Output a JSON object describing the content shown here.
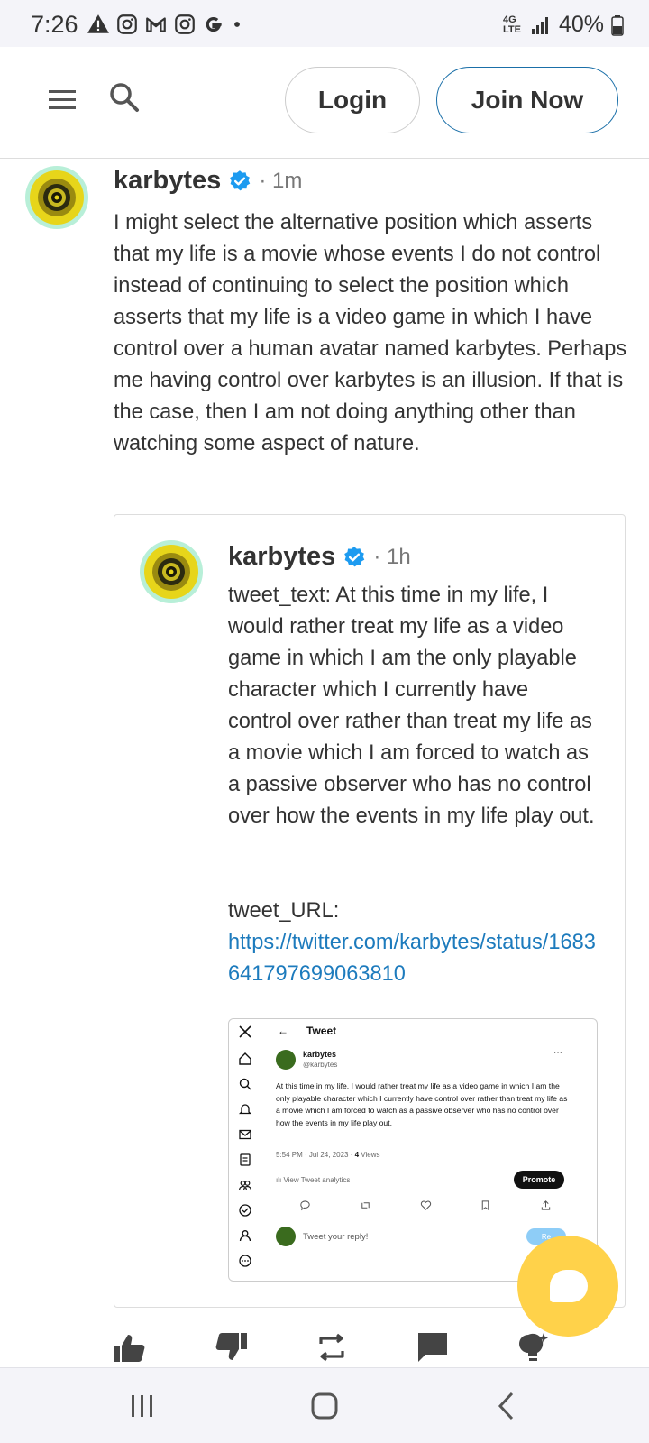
{
  "status_bar": {
    "time": "7:26",
    "battery": "40%",
    "network": "4G LTE"
  },
  "header": {
    "login_label": "Login",
    "join_label": "Join Now"
  },
  "post": {
    "username": "karbytes",
    "time": "· 1m",
    "text": "I might select the alternative position which asserts that my life is a movie whose events I do not control instead of continuing to select the position which asserts that my life is a video game in which I have control over a human avatar named karbytes. Perhaps me having control over karbytes is an illusion. If that is the case, then I am not doing anything other than watching some aspect of nature."
  },
  "quote": {
    "username": "karbytes",
    "time": "· 1h",
    "text": "tweet_text: At this time in my life, I would rather treat my life as a video game in which I am the only playable character which I currently have control over rather than treat my life as a movie which I am forced to watch as a passive observer who has no control over how the events in my life play out.",
    "url_label": "tweet_URL:",
    "url": "https://twitter.com/karbytes/status/1683641797699063810"
  },
  "screenshot": {
    "back_arrow": "←",
    "title": "Tweet",
    "name": "karbytes",
    "handle": "@karbytes",
    "more": "···",
    "body": "At this time in my life, I would rather treat my life as a video game in which I am the only playable character which I currently have control over rather than treat my life as a movie which I am forced to watch as a passive observer who has no control over how the events in my life play out.",
    "meta_prefix": "5:54 PM · Jul 24, 2023 · ",
    "views_count": "4",
    "views_label": " Views",
    "analytics": "View Tweet analytics",
    "promote": "Promote",
    "reply_placeholder": "Tweet your reply!",
    "reply_btn": "Re"
  },
  "colors": {
    "accent": "#1d7bbd",
    "verified": "#1d9bf0",
    "fab": "#ffd24a"
  },
  "icons": {
    "header": [
      "menu-icon",
      "search-icon"
    ],
    "actions": [
      "thumbs-up-icon",
      "thumbs-down-icon",
      "repost-icon",
      "comment-icon",
      "lightbulb-icon"
    ],
    "nav": [
      "recents-icon",
      "home-icon",
      "back-icon"
    ]
  }
}
